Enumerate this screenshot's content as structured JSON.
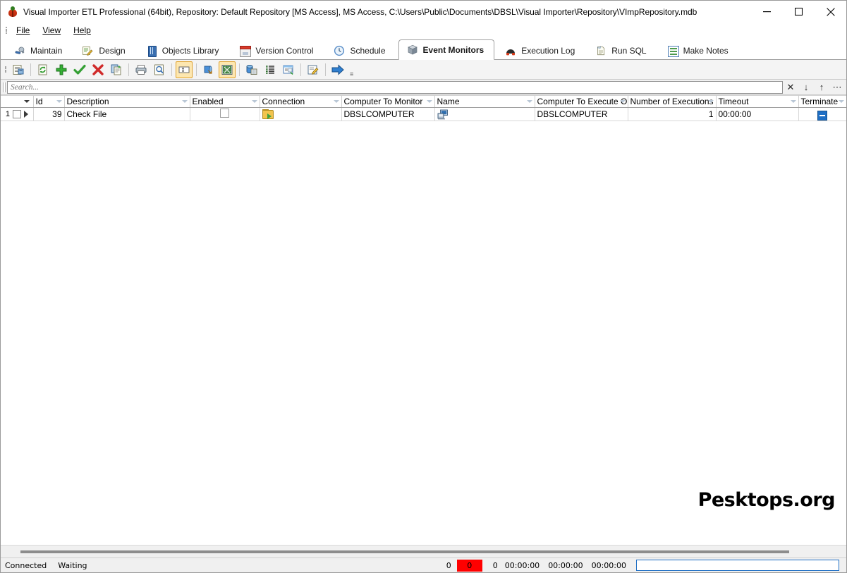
{
  "window": {
    "title": "Visual Importer ETL Professional (64bit), Repository: Default Repository  [MS Access], MS Access, C:\\Users\\Public\\Documents\\DBSL\\Visual Importer\\Repository\\VImpRepository.mdb",
    "app_icon": "ladybug-icon",
    "controls": {
      "minimize": "minimize-button",
      "maximize": "maximize-button",
      "close": "close-button"
    }
  },
  "menu": {
    "items": [
      "File",
      "View",
      "Help"
    ]
  },
  "tabs": [
    {
      "label": "Maintain",
      "icon": "wrench-icon",
      "active": false
    },
    {
      "label": "Design",
      "icon": "design-pencil-icon",
      "active": false
    },
    {
      "label": "Objects Library",
      "icon": "book-icon",
      "active": false
    },
    {
      "label": "Version Control",
      "icon": "calendar-icon",
      "active": false
    },
    {
      "label": "Schedule",
      "icon": "clock-icon",
      "active": false
    },
    {
      "label": "Event Monitors",
      "icon": "cube-icon",
      "active": true
    },
    {
      "label": "Execution Log",
      "icon": "log-icon",
      "active": false
    },
    {
      "label": "Run SQL",
      "icon": "sql-page-icon",
      "active": false
    },
    {
      "label": "Make Notes",
      "icon": "notes-grid-icon",
      "active": false
    }
  ],
  "toolbar": {
    "buttons": [
      {
        "name": "properties-icon",
        "selected": false
      },
      {
        "name": "refresh-icon",
        "selected": false
      },
      {
        "name": "add-icon",
        "selected": false
      },
      {
        "name": "confirm-icon",
        "selected": false
      },
      {
        "name": "delete-icon",
        "selected": false
      },
      {
        "name": "copy-icon",
        "selected": false
      },
      {
        "name": "print-icon",
        "selected": false
      },
      {
        "name": "print-preview-icon",
        "selected": false
      },
      {
        "name": "text-field-icon",
        "selected": true
      },
      {
        "name": "export-icon",
        "selected": false
      },
      {
        "name": "excel-export-icon",
        "selected": true
      },
      {
        "name": "database-icon",
        "selected": false
      },
      {
        "name": "list-icon",
        "selected": false
      },
      {
        "name": "form-icon",
        "selected": false
      },
      {
        "name": "edit-note-icon",
        "selected": false
      },
      {
        "name": "run-arrow-icon",
        "selected": false
      }
    ],
    "overflow_label": "≡"
  },
  "search": {
    "placeholder": "Search...",
    "value": "",
    "buttons": [
      {
        "name": "clear-search-button",
        "glyph": "✕"
      },
      {
        "name": "find-next-button",
        "glyph": "↓"
      },
      {
        "name": "find-prev-button",
        "glyph": "↑"
      },
      {
        "name": "search-options-button",
        "glyph": "⋯"
      }
    ]
  },
  "grid": {
    "columns": [
      {
        "key": "indicator",
        "label": ""
      },
      {
        "key": "id",
        "label": "Id"
      },
      {
        "key": "description",
        "label": "Description"
      },
      {
        "key": "enabled",
        "label": "Enabled"
      },
      {
        "key": "connection",
        "label": "Connection"
      },
      {
        "key": "computer_to_monitor",
        "label": "Computer To Monitor"
      },
      {
        "key": "name",
        "label": "Name"
      },
      {
        "key": "computer_to_execute_on",
        "label": "Computer To Execute On"
      },
      {
        "key": "number_of_executions",
        "label": "Number of Executions"
      },
      {
        "key": "timeout",
        "label": "Timeout"
      },
      {
        "key": "terminate",
        "label": "Terminate"
      }
    ],
    "rows": [
      {
        "row_number": "1",
        "id": "39",
        "description": "Check File",
        "enabled": "",
        "connection_icon": "folder-green-arrow-icon",
        "computer_to_monitor": "DBSLCOMPUTER",
        "name_icon": "computer-icon",
        "computer_to_execute_on": "DBSLCOMPUTER",
        "number_of_executions": "1",
        "timeout": "00:00:00",
        "terminate_state": "indeterminate"
      }
    ]
  },
  "watermark": {
    "text": "Pesktops.org"
  },
  "statusbar": {
    "connection_state": "Connected",
    "activity_state": "Waiting",
    "counter_1": "0",
    "counter_error": "0",
    "counter_2": "0",
    "time_1": "00:00:00",
    "time_2": "00:00:00",
    "time_3": "00:00:00",
    "progress_percent": 0,
    "error_color": "#ff0000",
    "progress_border_color": "#1f6fc4"
  }
}
